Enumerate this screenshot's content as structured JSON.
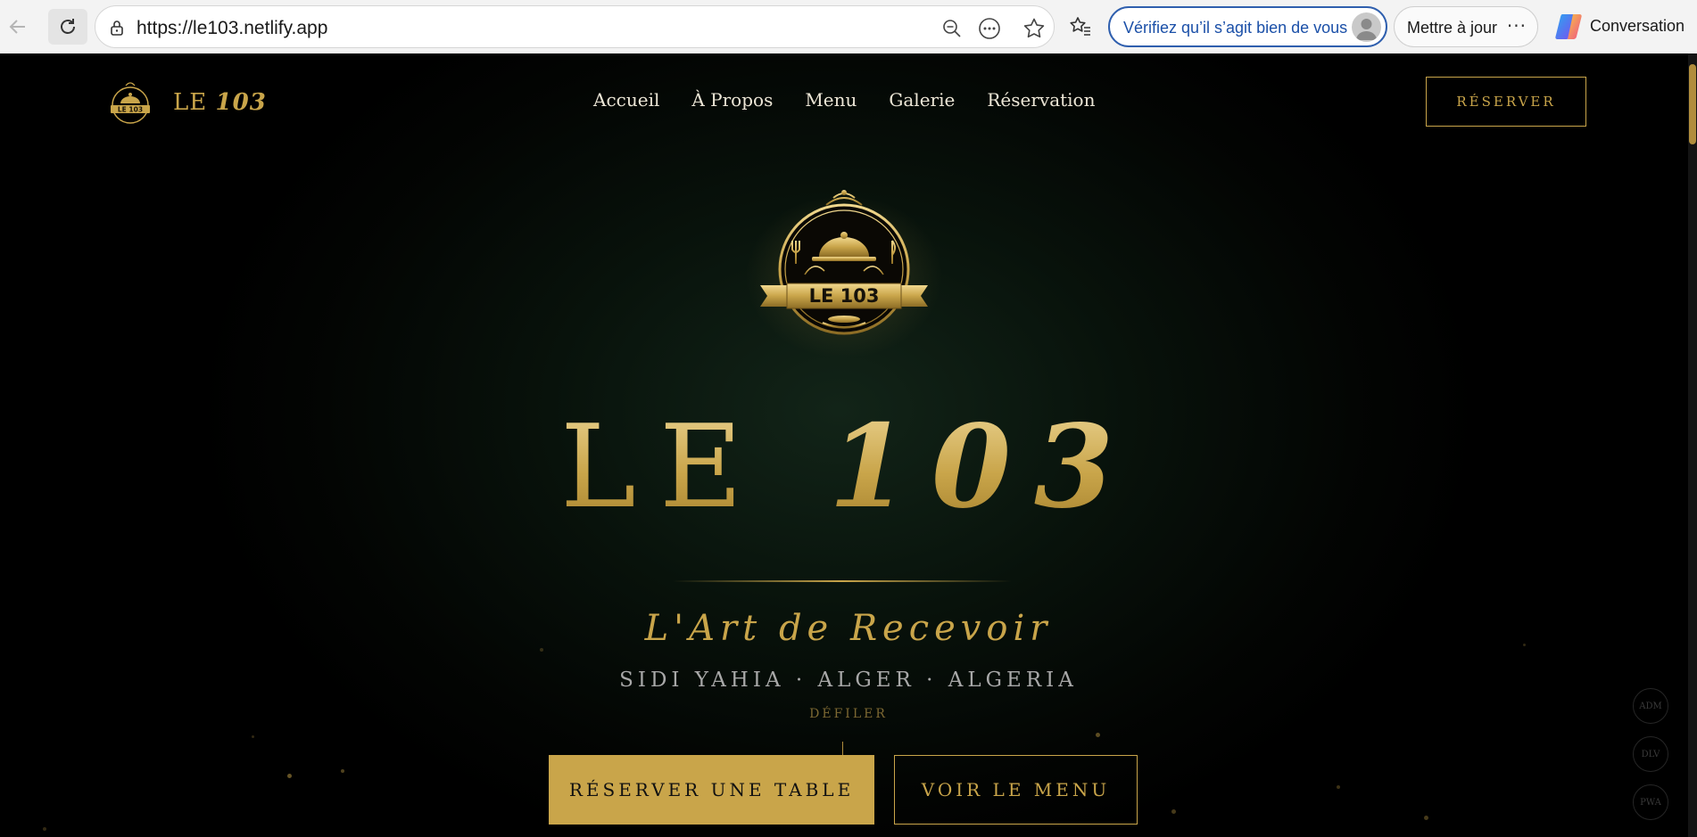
{
  "browser": {
    "url": "https://le103.netlify.app",
    "verify_label": "Vérifiez qu’il s’agit bien de vous",
    "update_label": "Mettre à jour",
    "update_more": "···",
    "copilot_label": "Conversation"
  },
  "site": {
    "brand_prefix": "LE",
    "brand_number": "103",
    "nav": [
      "Accueil",
      "À Propos",
      "Menu",
      "Galerie",
      "Réservation"
    ],
    "reserve_button": "RÉSERVER"
  },
  "emblem": {
    "text": "LE 103"
  },
  "hero": {
    "title_prefix": "LE",
    "title_number": "103",
    "tagline": "L'Art de Recevoir",
    "location": "SIDI YAHIA · ALGER · ALGERIA",
    "scroll_hint": "DÉFILER",
    "cta_primary": "RÉSERVER UNE TABLE",
    "cta_secondary": "VOIR LE MENU"
  },
  "side_shortcuts": [
    "ADM",
    "DLV",
    "PWA"
  ],
  "colors": {
    "gold": "#c9a54a",
    "background": "#030503",
    "browser_accent": "#2f5fae"
  }
}
